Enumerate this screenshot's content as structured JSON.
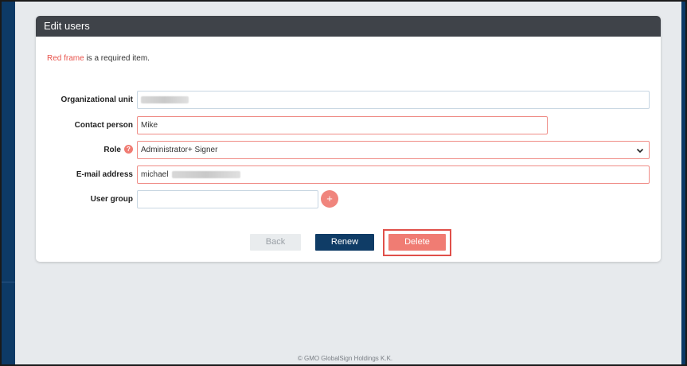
{
  "header": {
    "title": "Edit users"
  },
  "note": {
    "red_text": "Red frame",
    "rest_text": " is a required item."
  },
  "form": {
    "org_unit": {
      "label": "Organizational unit",
      "value": ""
    },
    "contact_person": {
      "label": "Contact person",
      "value": "Mike"
    },
    "role": {
      "label": "Role",
      "help": "?",
      "value": "Administrator+ Signer",
      "chevron": "⌄"
    },
    "email": {
      "label": "E-mail address",
      "value": "michael"
    },
    "user_group": {
      "label": "User group",
      "value": "",
      "add": "+"
    }
  },
  "buttons": {
    "back": "Back",
    "renew": "Renew",
    "delete": "Delete"
  },
  "footer": {
    "copyright": "© GMO GlobalSign Holdings K.K."
  },
  "colors": {
    "accent": "#f07c73",
    "primary": "#0f3c66",
    "header": "#3f4349"
  }
}
